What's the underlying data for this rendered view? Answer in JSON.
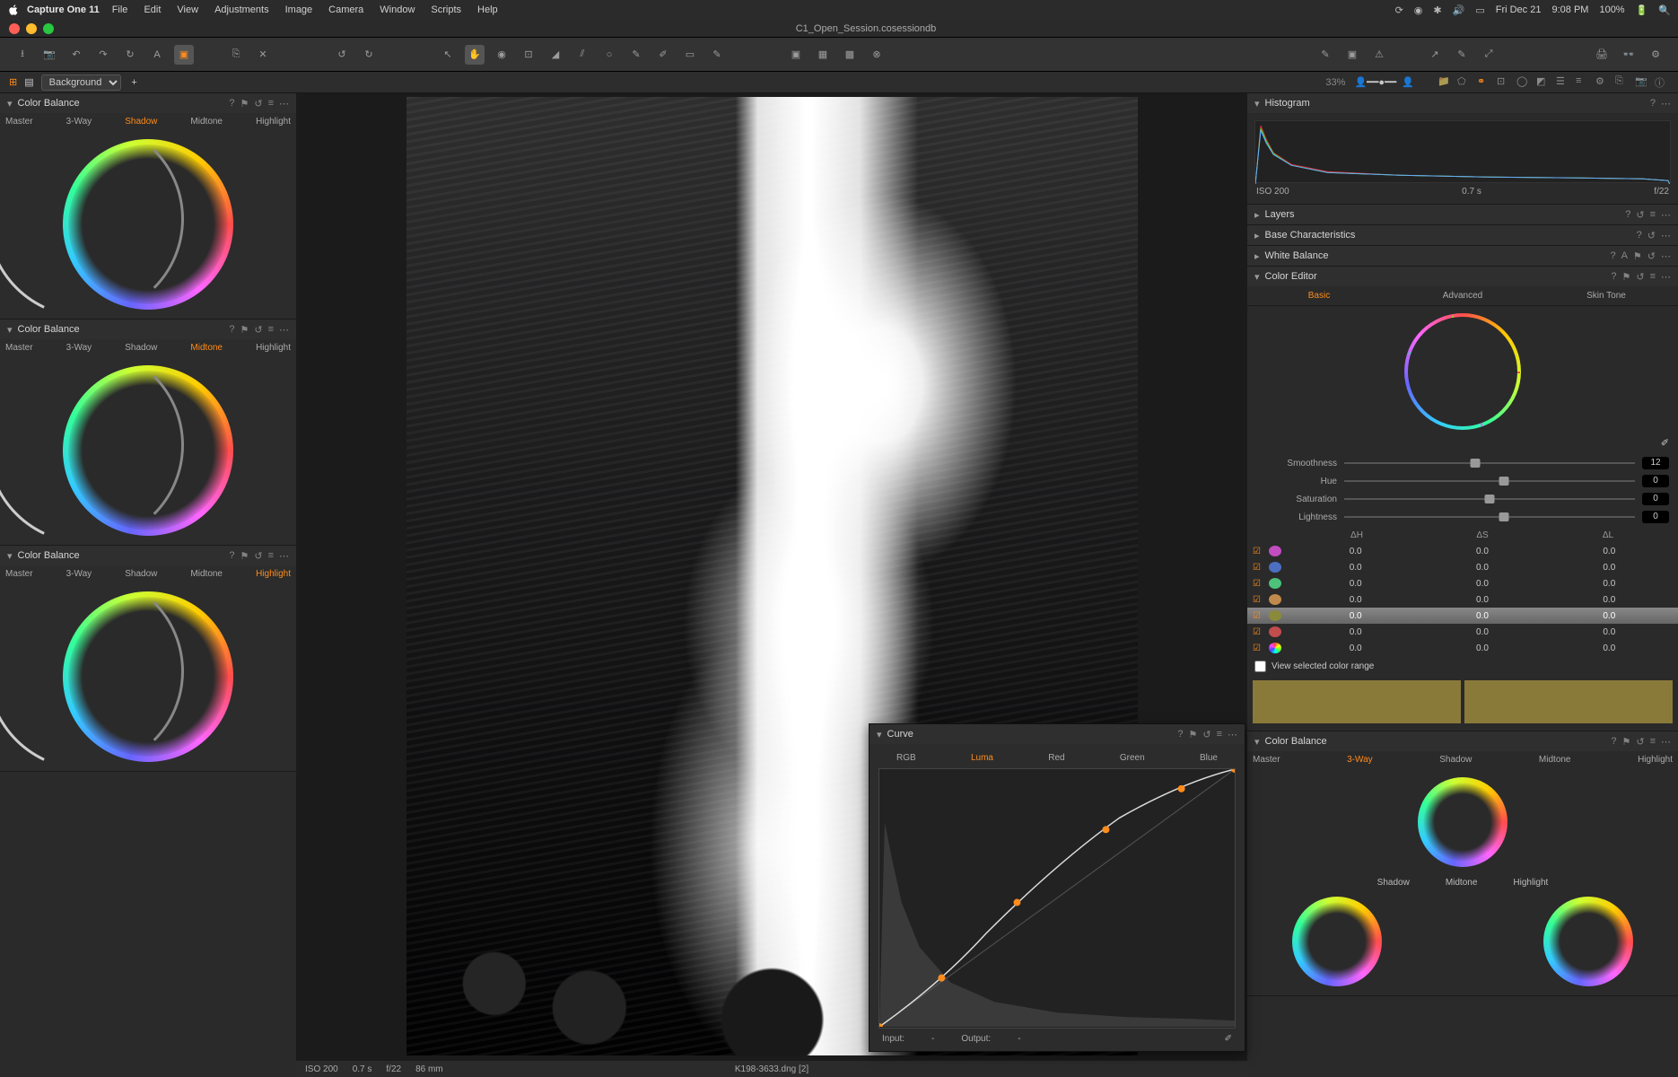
{
  "menubar": {
    "app": "Capture One 11",
    "items": [
      "File",
      "Edit",
      "View",
      "Adjustments",
      "Image",
      "Camera",
      "Window",
      "Scripts",
      "Help"
    ],
    "status_day": "Fri Dec 21",
    "status_time": "9:08 PM",
    "status_batt": "100%"
  },
  "titlebar": {
    "title": "C1_Open_Session.cosessiondb"
  },
  "layerbar": {
    "layer": "Background",
    "zoom": "33%"
  },
  "colorbalance": {
    "title": "Color Balance",
    "tabs": [
      "Master",
      "3-Way",
      "Shadow",
      "Midtone",
      "Highlight"
    ]
  },
  "histogram": {
    "title": "Histogram",
    "iso": "ISO 200",
    "shutter": "0.7 s",
    "aperture": "f/22"
  },
  "rightpanels": {
    "layers": "Layers",
    "basechar": "Base Characteristics",
    "wb": "White Balance",
    "coloreditor": "Color Editor"
  },
  "coloreditor": {
    "tabs": [
      "Basic",
      "Advanced",
      "Skin Tone"
    ],
    "sliders": {
      "smoothness": {
        "label": "Smoothness",
        "val": "12",
        "pos": 45
      },
      "hue": {
        "label": "Hue",
        "val": "0",
        "pos": 55
      },
      "saturation": {
        "label": "Saturation",
        "val": "0",
        "pos": 50
      },
      "lightness": {
        "label": "Lightness",
        "val": "0",
        "pos": 55
      }
    },
    "listhdr": [
      "ΔH",
      "ΔS",
      "ΔL"
    ],
    "rows": [
      {
        "color": "#c14dc1",
        "h": "0.0",
        "s": "0.0",
        "l": "0.0",
        "sel": false
      },
      {
        "color": "#4d6fc1",
        "h": "0.0",
        "s": "0.0",
        "l": "0.0",
        "sel": false
      },
      {
        "color": "#4dc17a",
        "h": "0.0",
        "s": "0.0",
        "l": "0.0",
        "sel": false
      },
      {
        "color": "#c18a4d",
        "h": "0.0",
        "s": "0.0",
        "l": "0.0",
        "sel": false
      },
      {
        "color": "#8a8a3a",
        "h": "0.0",
        "s": "0.0",
        "l": "0.0",
        "sel": true
      },
      {
        "color": "#c14d4d",
        "h": "0.0",
        "s": "0.0",
        "l": "0.0",
        "sel": false
      },
      {
        "color": "conic",
        "h": "0.0",
        "s": "0.0",
        "l": "0.0",
        "sel": false
      }
    ],
    "viewchk": "View selected color range"
  },
  "curve": {
    "title": "Curve",
    "tabs": [
      "RGB",
      "Luma",
      "Red",
      "Green",
      "Blue"
    ],
    "io_in": "Input:",
    "io_out": "Output:",
    "in_v": "-",
    "out_v": "-"
  },
  "cb3way": {
    "title": "Color Balance",
    "tabs": [
      "Master",
      "3-Way",
      "Shadow",
      "Midtone",
      "Highlight"
    ],
    "midtone": "Midtone",
    "shadow": "Shadow",
    "highlight": "Highlight"
  },
  "viewerfooter": {
    "iso": "ISO 200",
    "shutter": "0.7 s",
    "aperture": "f/22",
    "focal": "86 mm",
    "filename": "K198-3633.dng [2]"
  }
}
